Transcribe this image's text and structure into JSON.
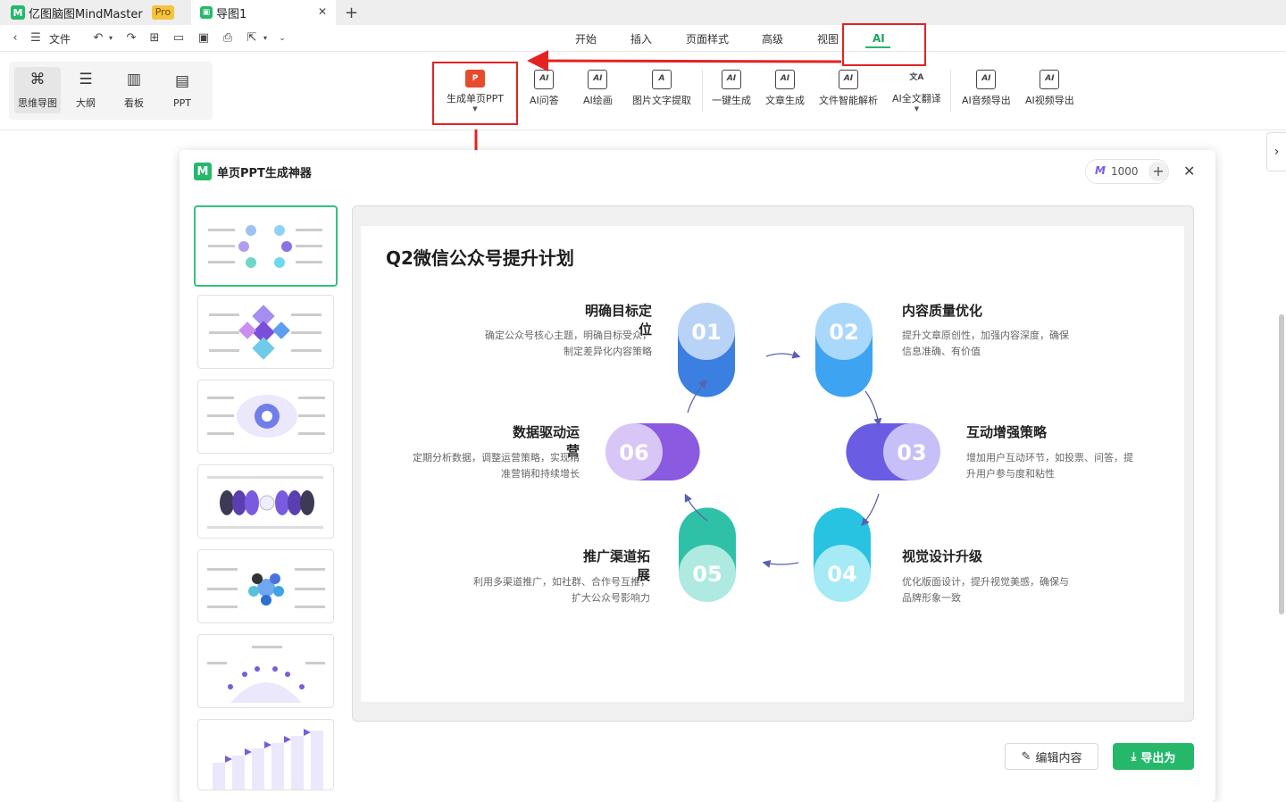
{
  "app": {
    "name": "亿图脑图MindMaster",
    "badge": "Pro",
    "doc_tab": "导图1",
    "new_tab": "+"
  },
  "menu": {
    "file": "文件",
    "tabs": [
      "开始",
      "插入",
      "页面样式",
      "高级",
      "视图",
      "AI"
    ],
    "active_tab": "AI"
  },
  "views": [
    {
      "label": "思维导图",
      "icon": "⌘"
    },
    {
      "label": "大纲",
      "icon": "☰"
    },
    {
      "label": "看板",
      "icon": "▥"
    },
    {
      "label": "PPT",
      "icon": "▤"
    }
  ],
  "ribbon": [
    {
      "label": "生成单页PPT",
      "icon": "P"
    },
    {
      "label": "AI问答",
      "icon": "AI"
    },
    {
      "label": "AI绘画",
      "icon": "AI"
    },
    {
      "label": "图片文字提取",
      "icon": "A"
    },
    {
      "label": "一键生成",
      "icon": "AI"
    },
    {
      "label": "文章生成",
      "icon": "AI"
    },
    {
      "label": "文件智能解析",
      "icon": "AI"
    },
    {
      "label": "AI全文翻译",
      "icon": "文A"
    },
    {
      "label": "AI音频导出",
      "icon": "AI"
    },
    {
      "label": "AI视频导出",
      "icon": "AI"
    }
  ],
  "dialog": {
    "title": "单页PPT生成神器",
    "credits": "1000",
    "edit_label": "编辑内容",
    "export_label": "导出为"
  },
  "slide": {
    "title": "Q2微信公众号提升计划",
    "nodes": [
      {
        "num": "01",
        "title": "明确目标定位",
        "desc1": "确定公众号核心主题，明确目标受众，",
        "desc2": "制定差异化内容策略",
        "color": "#3b7fe0",
        "light": "#b8d3f5"
      },
      {
        "num": "02",
        "title": "内容质量优化",
        "desc1": "提升文章原创性，加强内容深度，确保",
        "desc2": "信息准确、有价值",
        "color": "#3ea3f0",
        "light": "#a9d8fb"
      },
      {
        "num": "03",
        "title": "互动增强策略",
        "desc1": "增加用户互动环节，如投票、问答，提",
        "desc2": "升用户参与度和粘性",
        "color": "#6a5de3",
        "light": "#c7bff7"
      },
      {
        "num": "04",
        "title": "视觉设计升级",
        "desc1": "优化版面设计，提升视觉美感，确保与",
        "desc2": "品牌形象一致",
        "color": "#27c3e0",
        "light": "#a6eaf5"
      },
      {
        "num": "05",
        "title": "推广渠道拓展",
        "desc1": "利用多渠道推广，如社群、合作号互推，",
        "desc2": "扩大公众号影响力",
        "color": "#2fc1a7",
        "light": "#aeeadf"
      },
      {
        "num": "06",
        "title": "数据驱动运营",
        "desc1": "定期分析数据，调整运营策略，实现精",
        "desc2": "准营销和持续增长",
        "color": "#8a5ae0",
        "light": "#d8c6f7"
      }
    ]
  },
  "thumbnails": [
    "thumb-1",
    "thumb-2",
    "thumb-3",
    "thumb-4",
    "thumb-5",
    "thumb-6",
    "thumb-7"
  ]
}
